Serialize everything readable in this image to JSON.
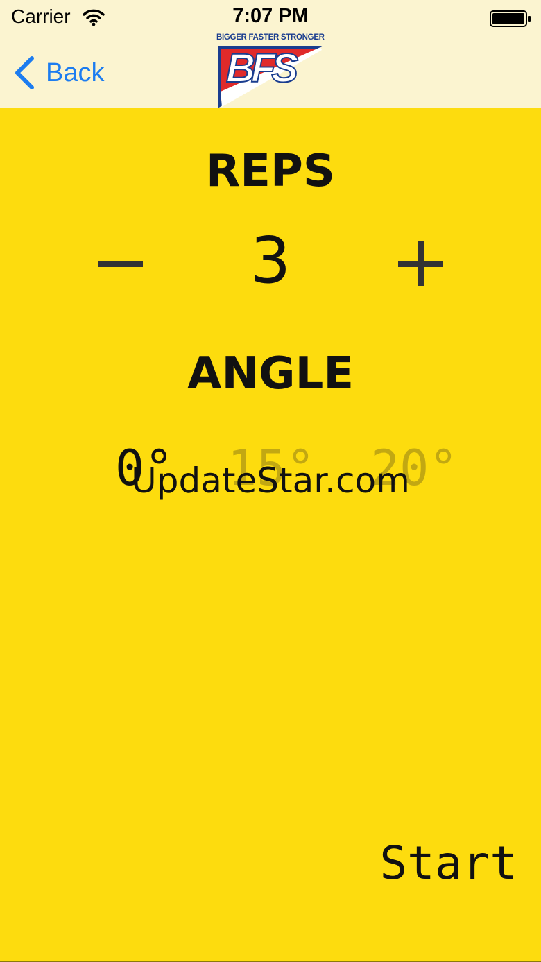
{
  "status_bar": {
    "carrier": "Carrier",
    "time": "7:07 PM",
    "wifi_icon": "wifi-icon",
    "battery_icon": "battery-icon"
  },
  "nav": {
    "back_label": "Back",
    "back_icon": "chevron-left-icon",
    "accent_color": "#1C7CF0",
    "logo": {
      "tagline": "BIGGER FASTER STRONGER",
      "letters": "BFS",
      "colors": {
        "red": "#E02A2A",
        "blue": "#1A3D8F"
      }
    }
  },
  "reps": {
    "title": "REPS",
    "value": "3",
    "decrement_icon": "minus-icon",
    "increment_icon": "plus-icon"
  },
  "angle": {
    "title": "ANGLE",
    "options": [
      {
        "label": "0°",
        "selected": true
      },
      {
        "label": "15°",
        "selected": false
      },
      {
        "label": "20°",
        "selected": false
      }
    ]
  },
  "watermark": "UpdateStar.com",
  "start_label": "Start",
  "colors": {
    "background": "#FDDC0E",
    "header_background": "#FBF4D0",
    "unselected_option": "#C2A812"
  }
}
